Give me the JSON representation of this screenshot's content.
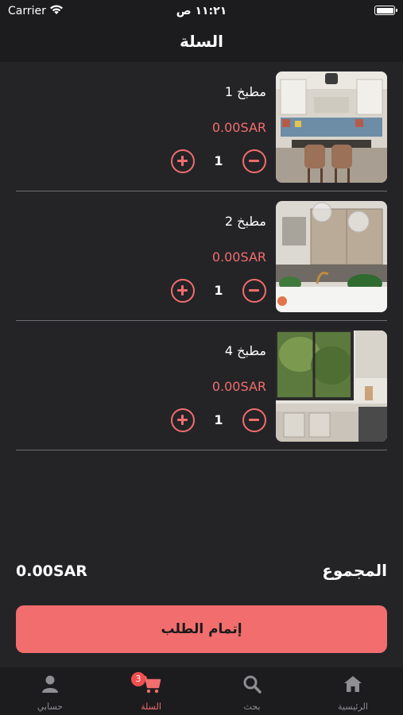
{
  "status_bar": {
    "carrier": "Carrier",
    "time": "١١:٢١ ص"
  },
  "header": {
    "title": "السلة"
  },
  "cart": {
    "items": [
      {
        "name": "مطبخ 1",
        "price": "0.00SAR",
        "quantity": "1"
      },
      {
        "name": "مطبخ 2",
        "price": "0.00SAR",
        "quantity": "1"
      },
      {
        "name": "مطبخ 4",
        "price": "0.00SAR",
        "quantity": "1"
      }
    ]
  },
  "summary": {
    "total_label": "المجموع",
    "total_value": "0.00SAR"
  },
  "checkout": {
    "label": "إتمام الطلب"
  },
  "tab_bar": {
    "tabs": [
      {
        "label": "الرئيسية",
        "icon": "home-icon"
      },
      {
        "label": "بحث",
        "icon": "search-icon"
      },
      {
        "label": "السلة",
        "icon": "cart-icon",
        "badge": "3",
        "active": true
      },
      {
        "label": "حسابي",
        "icon": "user-icon"
      }
    ]
  },
  "colors": {
    "accent": "#f26d6d",
    "background": "#242427",
    "bar": "#1c1c1e"
  }
}
